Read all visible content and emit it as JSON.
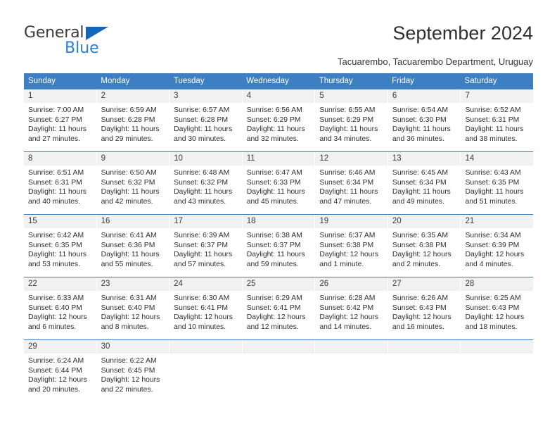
{
  "brand": {
    "name_top": "General",
    "name_bottom": "Blue",
    "accent_color": "#2b7fd4",
    "triangle_color": "#1565b8"
  },
  "header": {
    "title": "September 2024",
    "subtitle": "Tacuarembo, Tacuarembo Department, Uruguay"
  },
  "theme": {
    "header_band": "#3d7fc1",
    "daynum_band": "#f1f1f1",
    "text": "#2e2e2e"
  },
  "weekdays": [
    "Sunday",
    "Monday",
    "Tuesday",
    "Wednesday",
    "Thursday",
    "Friday",
    "Saturday"
  ],
  "weeks": [
    [
      {
        "day": "1",
        "sunrise": "Sunrise: 7:00 AM",
        "sunset": "Sunset: 6:27 PM",
        "daylight1": "Daylight: 11 hours",
        "daylight2": "and 27 minutes."
      },
      {
        "day": "2",
        "sunrise": "Sunrise: 6:59 AM",
        "sunset": "Sunset: 6:28 PM",
        "daylight1": "Daylight: 11 hours",
        "daylight2": "and 29 minutes."
      },
      {
        "day": "3",
        "sunrise": "Sunrise: 6:57 AM",
        "sunset": "Sunset: 6:28 PM",
        "daylight1": "Daylight: 11 hours",
        "daylight2": "and 30 minutes."
      },
      {
        "day": "4",
        "sunrise": "Sunrise: 6:56 AM",
        "sunset": "Sunset: 6:29 PM",
        "daylight1": "Daylight: 11 hours",
        "daylight2": "and 32 minutes."
      },
      {
        "day": "5",
        "sunrise": "Sunrise: 6:55 AM",
        "sunset": "Sunset: 6:29 PM",
        "daylight1": "Daylight: 11 hours",
        "daylight2": "and 34 minutes."
      },
      {
        "day": "6",
        "sunrise": "Sunrise: 6:54 AM",
        "sunset": "Sunset: 6:30 PM",
        "daylight1": "Daylight: 11 hours",
        "daylight2": "and 36 minutes."
      },
      {
        "day": "7",
        "sunrise": "Sunrise: 6:52 AM",
        "sunset": "Sunset: 6:31 PM",
        "daylight1": "Daylight: 11 hours",
        "daylight2": "and 38 minutes."
      }
    ],
    [
      {
        "day": "8",
        "sunrise": "Sunrise: 6:51 AM",
        "sunset": "Sunset: 6:31 PM",
        "daylight1": "Daylight: 11 hours",
        "daylight2": "and 40 minutes."
      },
      {
        "day": "9",
        "sunrise": "Sunrise: 6:50 AM",
        "sunset": "Sunset: 6:32 PM",
        "daylight1": "Daylight: 11 hours",
        "daylight2": "and 42 minutes."
      },
      {
        "day": "10",
        "sunrise": "Sunrise: 6:48 AM",
        "sunset": "Sunset: 6:32 PM",
        "daylight1": "Daylight: 11 hours",
        "daylight2": "and 43 minutes."
      },
      {
        "day": "11",
        "sunrise": "Sunrise: 6:47 AM",
        "sunset": "Sunset: 6:33 PM",
        "daylight1": "Daylight: 11 hours",
        "daylight2": "and 45 minutes."
      },
      {
        "day": "12",
        "sunrise": "Sunrise: 6:46 AM",
        "sunset": "Sunset: 6:34 PM",
        "daylight1": "Daylight: 11 hours",
        "daylight2": "and 47 minutes."
      },
      {
        "day": "13",
        "sunrise": "Sunrise: 6:45 AM",
        "sunset": "Sunset: 6:34 PM",
        "daylight1": "Daylight: 11 hours",
        "daylight2": "and 49 minutes."
      },
      {
        "day": "14",
        "sunrise": "Sunrise: 6:43 AM",
        "sunset": "Sunset: 6:35 PM",
        "daylight1": "Daylight: 11 hours",
        "daylight2": "and 51 minutes."
      }
    ],
    [
      {
        "day": "15",
        "sunrise": "Sunrise: 6:42 AM",
        "sunset": "Sunset: 6:35 PM",
        "daylight1": "Daylight: 11 hours",
        "daylight2": "and 53 minutes."
      },
      {
        "day": "16",
        "sunrise": "Sunrise: 6:41 AM",
        "sunset": "Sunset: 6:36 PM",
        "daylight1": "Daylight: 11 hours",
        "daylight2": "and 55 minutes."
      },
      {
        "day": "17",
        "sunrise": "Sunrise: 6:39 AM",
        "sunset": "Sunset: 6:37 PM",
        "daylight1": "Daylight: 11 hours",
        "daylight2": "and 57 minutes."
      },
      {
        "day": "18",
        "sunrise": "Sunrise: 6:38 AM",
        "sunset": "Sunset: 6:37 PM",
        "daylight1": "Daylight: 11 hours",
        "daylight2": "and 59 minutes."
      },
      {
        "day": "19",
        "sunrise": "Sunrise: 6:37 AM",
        "sunset": "Sunset: 6:38 PM",
        "daylight1": "Daylight: 12 hours",
        "daylight2": "and 1 minute."
      },
      {
        "day": "20",
        "sunrise": "Sunrise: 6:35 AM",
        "sunset": "Sunset: 6:38 PM",
        "daylight1": "Daylight: 12 hours",
        "daylight2": "and 2 minutes."
      },
      {
        "day": "21",
        "sunrise": "Sunrise: 6:34 AM",
        "sunset": "Sunset: 6:39 PM",
        "daylight1": "Daylight: 12 hours",
        "daylight2": "and 4 minutes."
      }
    ],
    [
      {
        "day": "22",
        "sunrise": "Sunrise: 6:33 AM",
        "sunset": "Sunset: 6:40 PM",
        "daylight1": "Daylight: 12 hours",
        "daylight2": "and 6 minutes."
      },
      {
        "day": "23",
        "sunrise": "Sunrise: 6:31 AM",
        "sunset": "Sunset: 6:40 PM",
        "daylight1": "Daylight: 12 hours",
        "daylight2": "and 8 minutes."
      },
      {
        "day": "24",
        "sunrise": "Sunrise: 6:30 AM",
        "sunset": "Sunset: 6:41 PM",
        "daylight1": "Daylight: 12 hours",
        "daylight2": "and 10 minutes."
      },
      {
        "day": "25",
        "sunrise": "Sunrise: 6:29 AM",
        "sunset": "Sunset: 6:41 PM",
        "daylight1": "Daylight: 12 hours",
        "daylight2": "and 12 minutes."
      },
      {
        "day": "26",
        "sunrise": "Sunrise: 6:28 AM",
        "sunset": "Sunset: 6:42 PM",
        "daylight1": "Daylight: 12 hours",
        "daylight2": "and 14 minutes."
      },
      {
        "day": "27",
        "sunrise": "Sunrise: 6:26 AM",
        "sunset": "Sunset: 6:43 PM",
        "daylight1": "Daylight: 12 hours",
        "daylight2": "and 16 minutes."
      },
      {
        "day": "28",
        "sunrise": "Sunrise: 6:25 AM",
        "sunset": "Sunset: 6:43 PM",
        "daylight1": "Daylight: 12 hours",
        "daylight2": "and 18 minutes."
      }
    ],
    [
      {
        "day": "29",
        "sunrise": "Sunrise: 6:24 AM",
        "sunset": "Sunset: 6:44 PM",
        "daylight1": "Daylight: 12 hours",
        "daylight2": "and 20 minutes."
      },
      {
        "day": "30",
        "sunrise": "Sunrise: 6:22 AM",
        "sunset": "Sunset: 6:45 PM",
        "daylight1": "Daylight: 12 hours",
        "daylight2": "and 22 minutes."
      },
      {
        "day": "",
        "sunrise": "",
        "sunset": "",
        "daylight1": "",
        "daylight2": ""
      },
      {
        "day": "",
        "sunrise": "",
        "sunset": "",
        "daylight1": "",
        "daylight2": ""
      },
      {
        "day": "",
        "sunrise": "",
        "sunset": "",
        "daylight1": "",
        "daylight2": ""
      },
      {
        "day": "",
        "sunrise": "",
        "sunset": "",
        "daylight1": "",
        "daylight2": ""
      },
      {
        "day": "",
        "sunrise": "",
        "sunset": "",
        "daylight1": "",
        "daylight2": ""
      }
    ]
  ]
}
